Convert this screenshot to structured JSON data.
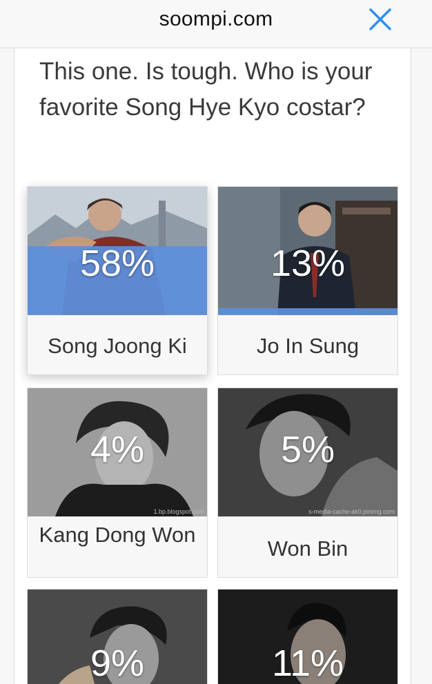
{
  "browser": {
    "domain": "soompi.com",
    "close_icon": "close-icon"
  },
  "poll": {
    "question": "This one. Is tough. Who is your favorite Song Hye Kyo costar?",
    "accent_color": "#5b8fdc",
    "options": [
      {
        "name": "Song Joong Ki",
        "percent_label": "58%",
        "percent": 58,
        "selected": true,
        "watermark": ""
      },
      {
        "name": "Jo In Sung",
        "percent_label": "13%",
        "percent": 13,
        "selected": false,
        "watermark": ""
      },
      {
        "name": "Kang Dong Won",
        "percent_label": "4%",
        "percent": 4,
        "selected": false,
        "watermark": "1.bp.blogspot.com"
      },
      {
        "name": "Won Bin",
        "percent_label": "5%",
        "percent": 5,
        "selected": false,
        "watermark": "s-media-cache-ak0.pinimg.com"
      },
      {
        "name": "",
        "percent_label": "9%",
        "percent": 9,
        "selected": false,
        "watermark": ""
      },
      {
        "name": "",
        "percent_label": "11%",
        "percent": 11,
        "selected": false,
        "watermark": ""
      }
    ]
  }
}
